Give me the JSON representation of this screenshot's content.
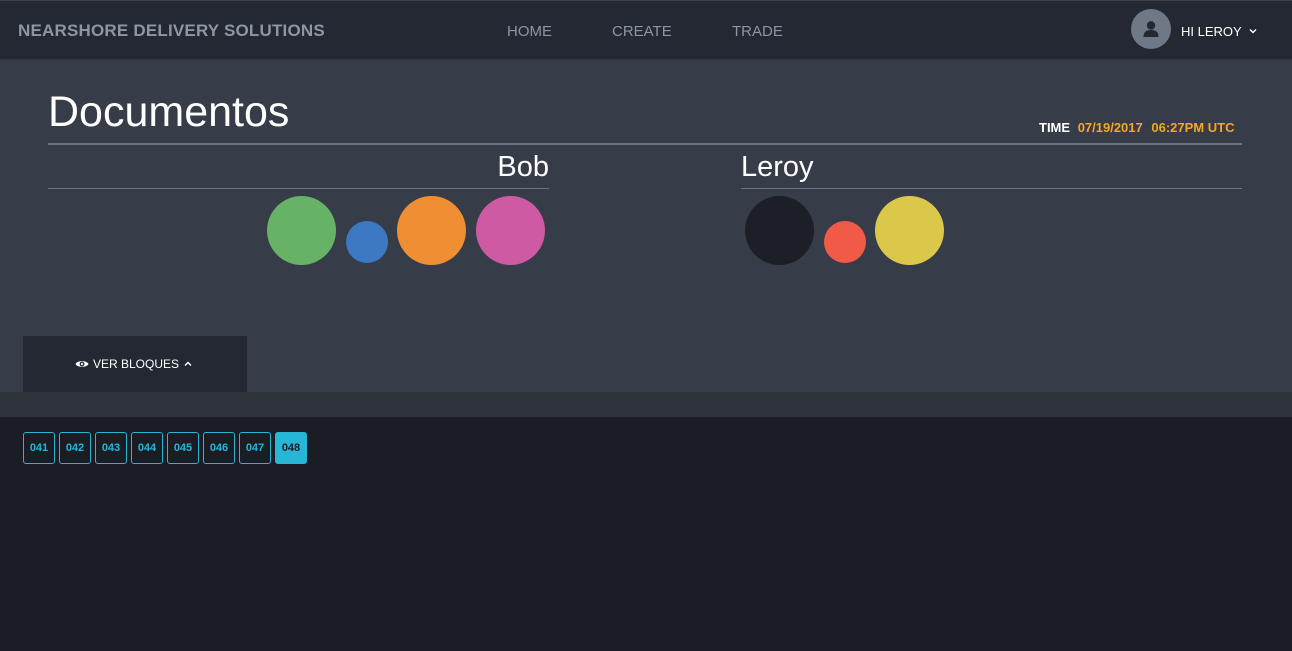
{
  "navbar": {
    "brand": "NEARSHORE DELIVERY SOLUTIONS",
    "links": [
      "HOME",
      "CREATE",
      "TRADE"
    ],
    "user_label": "HI LEROY"
  },
  "main": {
    "title": "Documentos",
    "time_label": "TIME",
    "time_date": "07/19/2017",
    "time_clock": "06:27PM UTC"
  },
  "parties": [
    {
      "name": "Bob",
      "tokens": [
        "green",
        "blue",
        "orange",
        "pink"
      ]
    },
    {
      "name": "Leroy",
      "tokens": [
        "black",
        "red",
        "yellow"
      ]
    }
  ],
  "colors": {
    "green": "#66b266",
    "blue": "#3d78c2",
    "orange": "#ef8e32",
    "pink": "#cd5aa3",
    "black": "#1c1f25",
    "red": "#f15a47",
    "yellow": "#dbc84b",
    "accent": "#27b6d6",
    "time": "#f5a623"
  },
  "toggle": {
    "label": "VER BLOQUES"
  },
  "blocks": {
    "items": [
      "041",
      "042",
      "043",
      "044",
      "045",
      "046",
      "047",
      "048"
    ],
    "active": "048"
  }
}
